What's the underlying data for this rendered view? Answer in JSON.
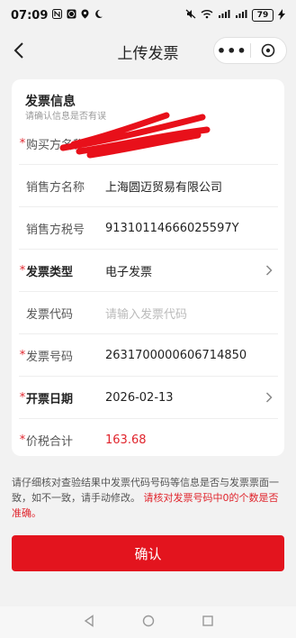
{
  "status_bar": {
    "time": "07:09",
    "left_icons": [
      "n-icon",
      "alarm-icon",
      "location-icon",
      "moon-icon"
    ],
    "right_icons": [
      "mute-icon",
      "wifi-icon",
      "signal-icon",
      "signal-icon"
    ],
    "battery": "79"
  },
  "navbar": {
    "title": "上传发票",
    "more": "•••"
  },
  "card": {
    "title": "发票信息",
    "subtitle": "请确认信息是否有误",
    "rows": [
      {
        "required": "*",
        "label": "购买方名称",
        "value": ""
      },
      {
        "required": "",
        "label": "销售方名称",
        "value": "上海圆迈贸易有限公司"
      },
      {
        "required": "",
        "label": "销售方税号",
        "value": "91310114666025597Y"
      },
      {
        "required": "*",
        "label": "发票类型",
        "value": "电子发票"
      },
      {
        "required": "",
        "label": "发票代码",
        "placeholder": "请输入发票代码"
      },
      {
        "required": "*",
        "label": "发票号码",
        "value": "26317000006067148​50"
      },
      {
        "required": "*",
        "label": "开票日期",
        "value": "2026-02-13"
      },
      {
        "required": "*",
        "label": "价税合计",
        "value": "163.68"
      }
    ]
  },
  "notice": {
    "text": "请仔细核对查验结果中发票代码号码等信息是否与发票票面一致，如不一致，请手动修改。",
    "warning": "请核对发票号码中0的个数是否准确。"
  },
  "confirm_button": {
    "label": "确认"
  },
  "colors": {
    "accent": "#e3141e",
    "required": "#e0242c",
    "redaction": "#e8101a"
  }
}
